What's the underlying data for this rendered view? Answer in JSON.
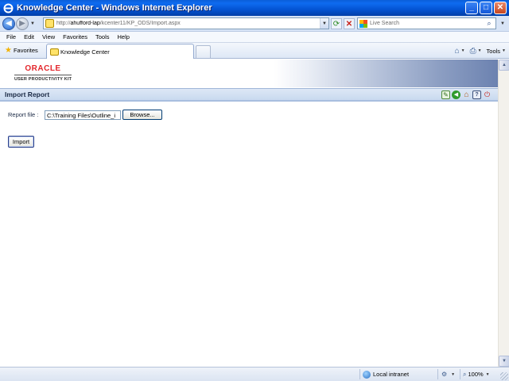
{
  "window": {
    "title": "Knowledge Center - Windows Internet Explorer"
  },
  "address_bar": {
    "url_prefix": "http://",
    "url_host": "ahufford-lap",
    "url_path": "/kcenter11/KP_ODS/Import.aspx",
    "search_placeholder": "Live Search"
  },
  "menu": {
    "items": [
      "File",
      "Edit",
      "View",
      "Favorites",
      "Tools",
      "Help"
    ]
  },
  "tabs": {
    "favorites_label": "Favorites",
    "active_tab_label": "Knowledge Center",
    "tools_label": "Tools"
  },
  "banner": {
    "logo_text": "ORACLE",
    "logo_subtext": "USER PRODUCTIVITY KIT"
  },
  "page": {
    "title": "Import Report",
    "report_file_label": "Report file :",
    "report_file_value": "C:\\Training Files\\Outline_i",
    "browse_label": "Browse...",
    "import_label": "Import"
  },
  "status_bar": {
    "zone": "Local intranet",
    "zoom": "100%"
  },
  "colors": {
    "title_bar": "#0453d3",
    "header_bar": "#c9d9ef",
    "oracle_red": "#e3262b"
  }
}
